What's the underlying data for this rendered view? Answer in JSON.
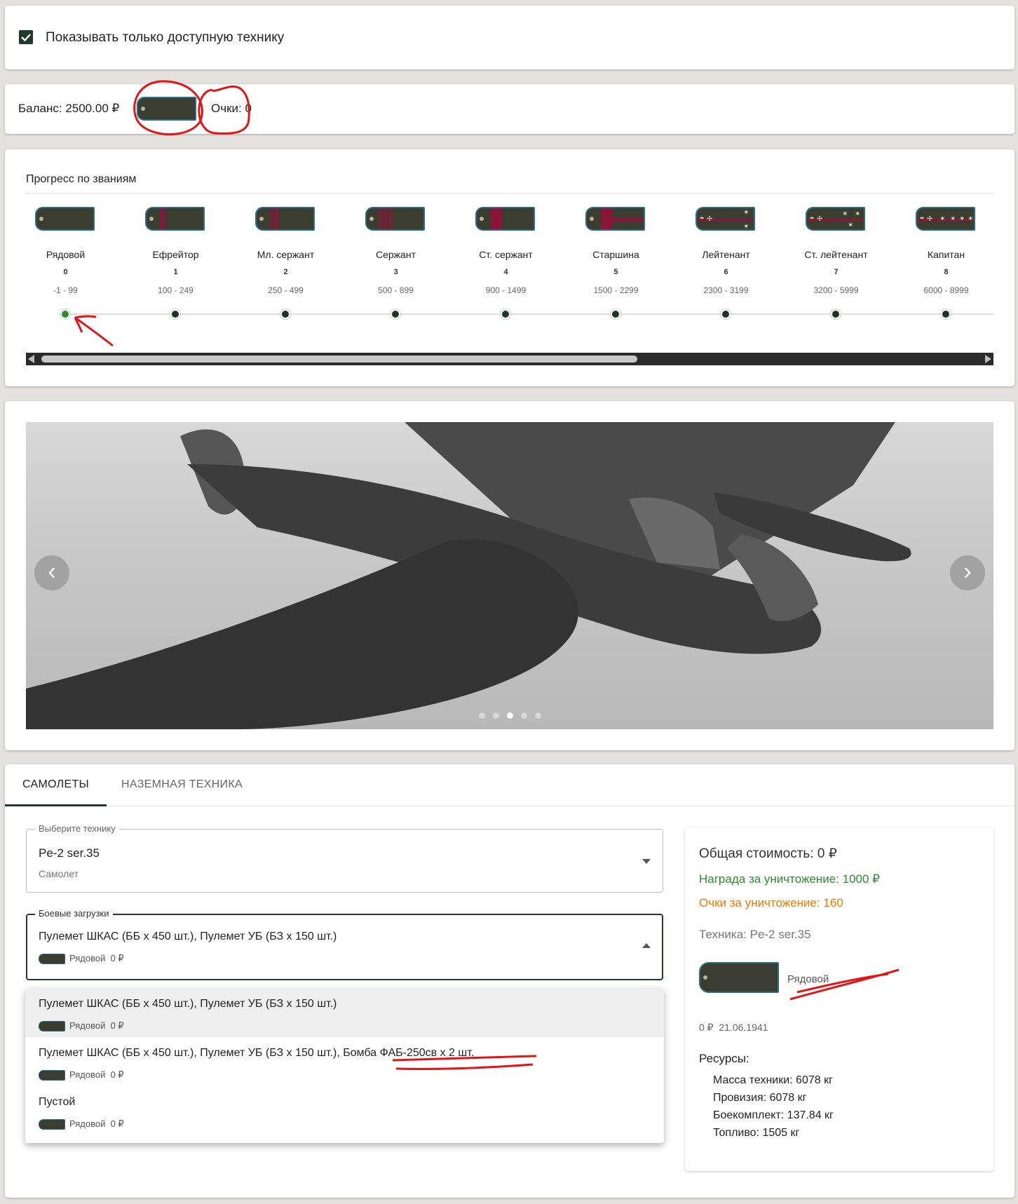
{
  "filter": {
    "label": "Показывать только доступную технику",
    "checked": true
  },
  "balance": {
    "label": "Баланс: 2500.00 ₽",
    "points": "Очки: 0"
  },
  "progress": {
    "title": "Прогресс по званиям",
    "ranks": [
      {
        "name": "Рядовой",
        "index": "0",
        "range": "-1 - 99"
      },
      {
        "name": "Ефрейтор",
        "index": "1",
        "range": "100 - 249"
      },
      {
        "name": "Мл. сержант",
        "index": "2",
        "range": "250 - 499"
      },
      {
        "name": "Сержант",
        "index": "3",
        "range": "500 - 899"
      },
      {
        "name": "Ст. сержант",
        "index": "4",
        "range": "900 - 1499"
      },
      {
        "name": "Старшина",
        "index": "5",
        "range": "1500 - 2299"
      },
      {
        "name": "Лейтенант",
        "index": "6",
        "range": "2300 - 3199"
      },
      {
        "name": "Ст. лейтенант",
        "index": "7",
        "range": "3200 - 5999"
      },
      {
        "name": "Капитан",
        "index": "8",
        "range": "6000 - 8999"
      }
    ],
    "current_rank_index": 0
  },
  "carousel": {
    "slides_count": 5,
    "active_slide": 3,
    "prev_icon": "‹",
    "next_icon": "›"
  },
  "tabs": [
    {
      "label": "САМОЛЕТЫ",
      "active": true
    },
    {
      "label": "НАЗЕМНАЯ ТЕХНИКА",
      "active": false
    }
  ],
  "vehicle_select": {
    "label": "Выберите технику",
    "value": "Pe-2 ser.35",
    "sub": "Самолет"
  },
  "loadout_select": {
    "label": "Боевые загрузки",
    "value": "Пулемет ШКАС (ББ x 450 шт.), Пулемет УБ (БЗ x 150 шт.)",
    "rank": "Рядовой",
    "price": "0 ₽",
    "options": [
      {
        "text": "Пулемет ШКАС (ББ x 450 шт.), Пулемет УБ (БЗ x 150 шт.)",
        "rank": "Рядовой",
        "price": "0 ₽"
      },
      {
        "text": "Пулемет ШКАС (ББ x 450 шт.), Пулемет УБ (БЗ x 150 шт.), Бомба ФАБ-250св x 2 шт.",
        "rank": "Рядовой",
        "price": "0 ₽"
      },
      {
        "text": "Пустой",
        "rank": "Рядовой",
        "price": "0 ₽"
      }
    ]
  },
  "summary": {
    "total": "Общая стоимость: 0 ₽",
    "reward": "Награда за уничтожение: 1000 ₽",
    "points": "Очки за уничтожение: 160",
    "vehicle": "Техника: Pe-2 ser.35",
    "rank": "Рядовой",
    "price_date": "0 ₽  21.06.1941",
    "resources_title": "Ресурсы:",
    "resources": [
      "Масса техники: 6078 кг",
      "Провизия: 6078 кг",
      "Боекомплект: 137.84 кг",
      "Топливо: 1505 кг"
    ],
    "colors": {
      "reward": "#2e8b2e",
      "points": "#f07800"
    }
  }
}
